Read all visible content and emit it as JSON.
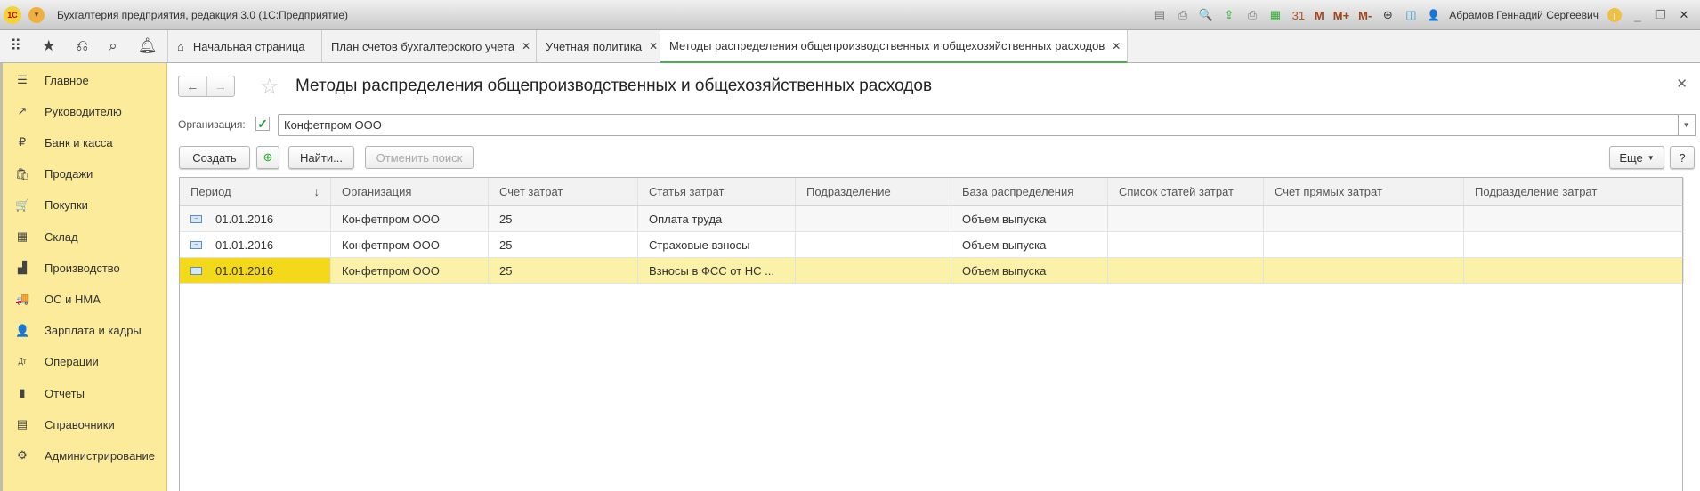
{
  "window": {
    "title": "Бухгалтерия предприятия, редакция 3.0  (1С:Предприятие)",
    "logo": "1С",
    "user": "Абрамов Геннадий Сергеевич",
    "memory_buttons": [
      "M",
      "M+",
      "M-"
    ]
  },
  "tabs": [
    {
      "label": "Начальная страница",
      "icon": "home-icon",
      "closable": false
    },
    {
      "label": "План счетов бухгалтерского учета",
      "closable": true
    },
    {
      "label": "Учетная политика",
      "closable": true
    },
    {
      "label": "Методы распределения общепроизводственных и общехозяйственных расходов",
      "closable": true,
      "active": true
    }
  ],
  "sidebar": {
    "items": [
      {
        "label": "Главное",
        "icon": "☰"
      },
      {
        "label": "Руководителю",
        "icon": "↗"
      },
      {
        "label": "Банк и касса",
        "icon": "₽"
      },
      {
        "label": "Продажи",
        "icon": "🛍"
      },
      {
        "label": "Покупки",
        "icon": "🛒"
      },
      {
        "label": "Склад",
        "icon": "▦"
      },
      {
        "label": "Производство",
        "icon": "▟"
      },
      {
        "label": "ОС и НМА",
        "icon": "🚚"
      },
      {
        "label": "Зарплата и кадры",
        "icon": "👤"
      },
      {
        "label": "Операции",
        "icon": "Дт"
      },
      {
        "label": "Отчеты",
        "icon": "▮"
      },
      {
        "label": "Справочники",
        "icon": "▤"
      },
      {
        "label": "Администрирование",
        "icon": "⚙"
      }
    ]
  },
  "form": {
    "title": "Методы распределения общепроизводственных и общехозяйственных расходов",
    "org_label": "Организация:",
    "org_value": "Конфетпром ООО",
    "buttons": {
      "create": "Создать",
      "find": "Найти...",
      "cancel_search": "Отменить поиск",
      "more": "Еще",
      "help": "?"
    }
  },
  "table": {
    "columns": [
      "Период",
      "Организация",
      "Счет затрат",
      "Статья затрат",
      "Подразделение",
      "База распределения",
      "Список статей затрат",
      "Счет прямых затрат",
      "Подразделение затрат"
    ],
    "sort_indicator": "↓",
    "rows": [
      [
        "01.01.2016",
        "Конфетпром ООО",
        "25",
        "Оплата труда",
        "",
        "Объем выпуска",
        "",
        "",
        ""
      ],
      [
        "01.01.2016",
        "Конфетпром ООО",
        "25",
        "Страховые взносы",
        "",
        "Объем выпуска",
        "",
        "",
        ""
      ],
      [
        "01.01.2016",
        "Конфетпром ООО",
        "25",
        "Взносы в ФСС от НС ...",
        "",
        "Объем выпуска",
        "",
        "",
        ""
      ]
    ],
    "selected_row": 2
  }
}
